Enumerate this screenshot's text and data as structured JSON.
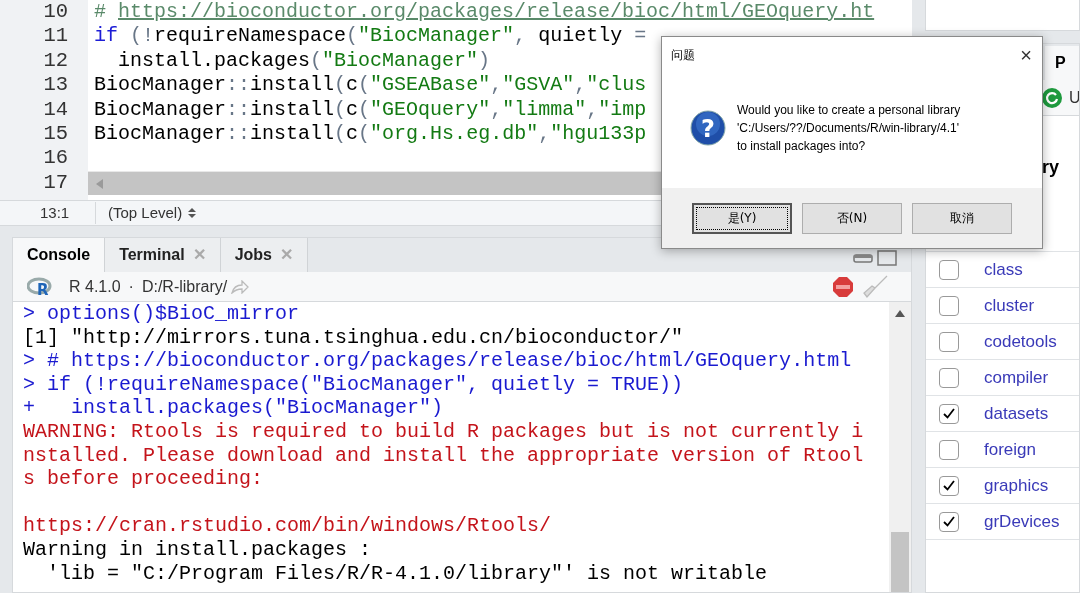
{
  "editor": {
    "line_numbers": [
      "10",
      "11",
      "12",
      "13",
      "14",
      "15",
      "16",
      "17"
    ],
    "lines": [
      [
        {
          "kind": "comment",
          "text": "# "
        },
        {
          "kind": "link",
          "text": "https://bioconductor.org/packages/release/bioc/html/GEOquery.ht"
        }
      ],
      [
        {
          "kind": "keyword",
          "text": "if"
        },
        {
          "kind": "punct",
          "text": " (!"
        },
        {
          "kind": "plain",
          "text": "requireNamespace"
        },
        {
          "kind": "punct",
          "text": "("
        },
        {
          "kind": "string",
          "text": "\"BiocManager\""
        },
        {
          "kind": "punct",
          "text": ", "
        },
        {
          "kind": "plain",
          "text": "quietly "
        },
        {
          "kind": "punct",
          "text": "="
        }
      ],
      [
        {
          "kind": "plain",
          "text": "  install.packages"
        },
        {
          "kind": "punct",
          "text": "("
        },
        {
          "kind": "string",
          "text": "\"BiocManager\""
        },
        {
          "kind": "punct",
          "text": ")"
        }
      ],
      [
        {
          "kind": "plain",
          "text": "BiocManager"
        },
        {
          "kind": "punct",
          "text": "::"
        },
        {
          "kind": "plain",
          "text": "install"
        },
        {
          "kind": "punct",
          "text": "("
        },
        {
          "kind": "plain",
          "text": "c"
        },
        {
          "kind": "punct",
          "text": "("
        },
        {
          "kind": "string",
          "text": "\"GSEABase\""
        },
        {
          "kind": "punct",
          "text": ","
        },
        {
          "kind": "string",
          "text": "\"GSVA\""
        },
        {
          "kind": "punct",
          "text": ","
        },
        {
          "kind": "string",
          "text": "\"clus"
        }
      ],
      [
        {
          "kind": "plain",
          "text": "BiocManager"
        },
        {
          "kind": "punct",
          "text": "::"
        },
        {
          "kind": "plain",
          "text": "install"
        },
        {
          "kind": "punct",
          "text": "("
        },
        {
          "kind": "plain",
          "text": "c"
        },
        {
          "kind": "punct",
          "text": "("
        },
        {
          "kind": "string",
          "text": "\"GEOquery\""
        },
        {
          "kind": "punct",
          "text": ","
        },
        {
          "kind": "string",
          "text": "\"limma\""
        },
        {
          "kind": "punct",
          "text": ","
        },
        {
          "kind": "string",
          "text": "\"imp"
        }
      ],
      [
        {
          "kind": "plain",
          "text": "BiocManager"
        },
        {
          "kind": "punct",
          "text": "::"
        },
        {
          "kind": "plain",
          "text": "install"
        },
        {
          "kind": "punct",
          "text": "("
        },
        {
          "kind": "plain",
          "text": "c"
        },
        {
          "kind": "punct",
          "text": "("
        },
        {
          "kind": "string",
          "text": "\"org.Hs.eg.db\""
        },
        {
          "kind": "punct",
          "text": ","
        },
        {
          "kind": "string",
          "text": "\"hgu133p"
        }
      ]
    ],
    "position": "13:1",
    "scope": "(Top Level)"
  },
  "console": {
    "tabs": [
      {
        "label": "Console",
        "selected": true
      },
      {
        "label": "Terminal",
        "selected": false,
        "close": "✕"
      },
      {
        "label": "Jobs",
        "selected": false,
        "close": "✕"
      }
    ],
    "logo": "R",
    "version": "R 4.1.0",
    "separator": "·",
    "path": "D:/R-library/",
    "lines": [
      {
        "kind": "input",
        "text": "> options()$BioC_mirror"
      },
      {
        "kind": "output",
        "text": "[1] \"http://mirrors.tuna.tsinghua.edu.cn/bioconductor/\""
      },
      {
        "kind": "input",
        "text": "> # https://bioconductor.org/packages/release/bioc/html/GEOquery.html"
      },
      {
        "kind": "input",
        "text": "> if (!requireNamespace(\"BiocManager\", quietly = TRUE))"
      },
      {
        "kind": "input",
        "text": "+   install.packages(\"BiocManager\")"
      },
      {
        "kind": "error",
        "text": "WARNING: Rtools is required to build R packages but is not currently i"
      },
      {
        "kind": "error",
        "text": "nstalled. Please download and install the appropriate version of Rtool"
      },
      {
        "kind": "error",
        "text": "s before proceeding:"
      },
      {
        "kind": "blank"
      },
      {
        "kind": "error",
        "text": "https://cran.rstudio.com/bin/windows/Rtools/"
      },
      {
        "kind": "output",
        "text": "Warning in install.packages :"
      },
      {
        "kind": "output",
        "text": "  'lib = \"C:/Program Files/R/R-4.1.0/library\"' is not writable"
      }
    ]
  },
  "packages_pane": {
    "tab": "P",
    "toolbar_text": "U",
    "heading": "ry",
    "rows": [
      {
        "name": "class",
        "checked": false
      },
      {
        "name": "cluster",
        "checked": false
      },
      {
        "name": "codetools",
        "checked": false
      },
      {
        "name": "compiler",
        "checked": false
      },
      {
        "name": "datasets",
        "checked": true
      },
      {
        "name": "foreign",
        "checked": false
      },
      {
        "name": "graphics",
        "checked": true
      },
      {
        "name": "grDevices",
        "checked": true
      }
    ]
  },
  "dialog": {
    "title": "问题",
    "close": "×",
    "icon_glyph": "?",
    "message": [
      "Would you like to create a personal library",
      "'C:/Users/??/Documents/R/win-library/4.1'",
      "to install packages into?"
    ],
    "buttons": [
      {
        "label": "是(Y)",
        "focused": true
      },
      {
        "label": "否(N)",
        "focused": false
      },
      {
        "label": "取消",
        "focused": false
      }
    ]
  }
}
